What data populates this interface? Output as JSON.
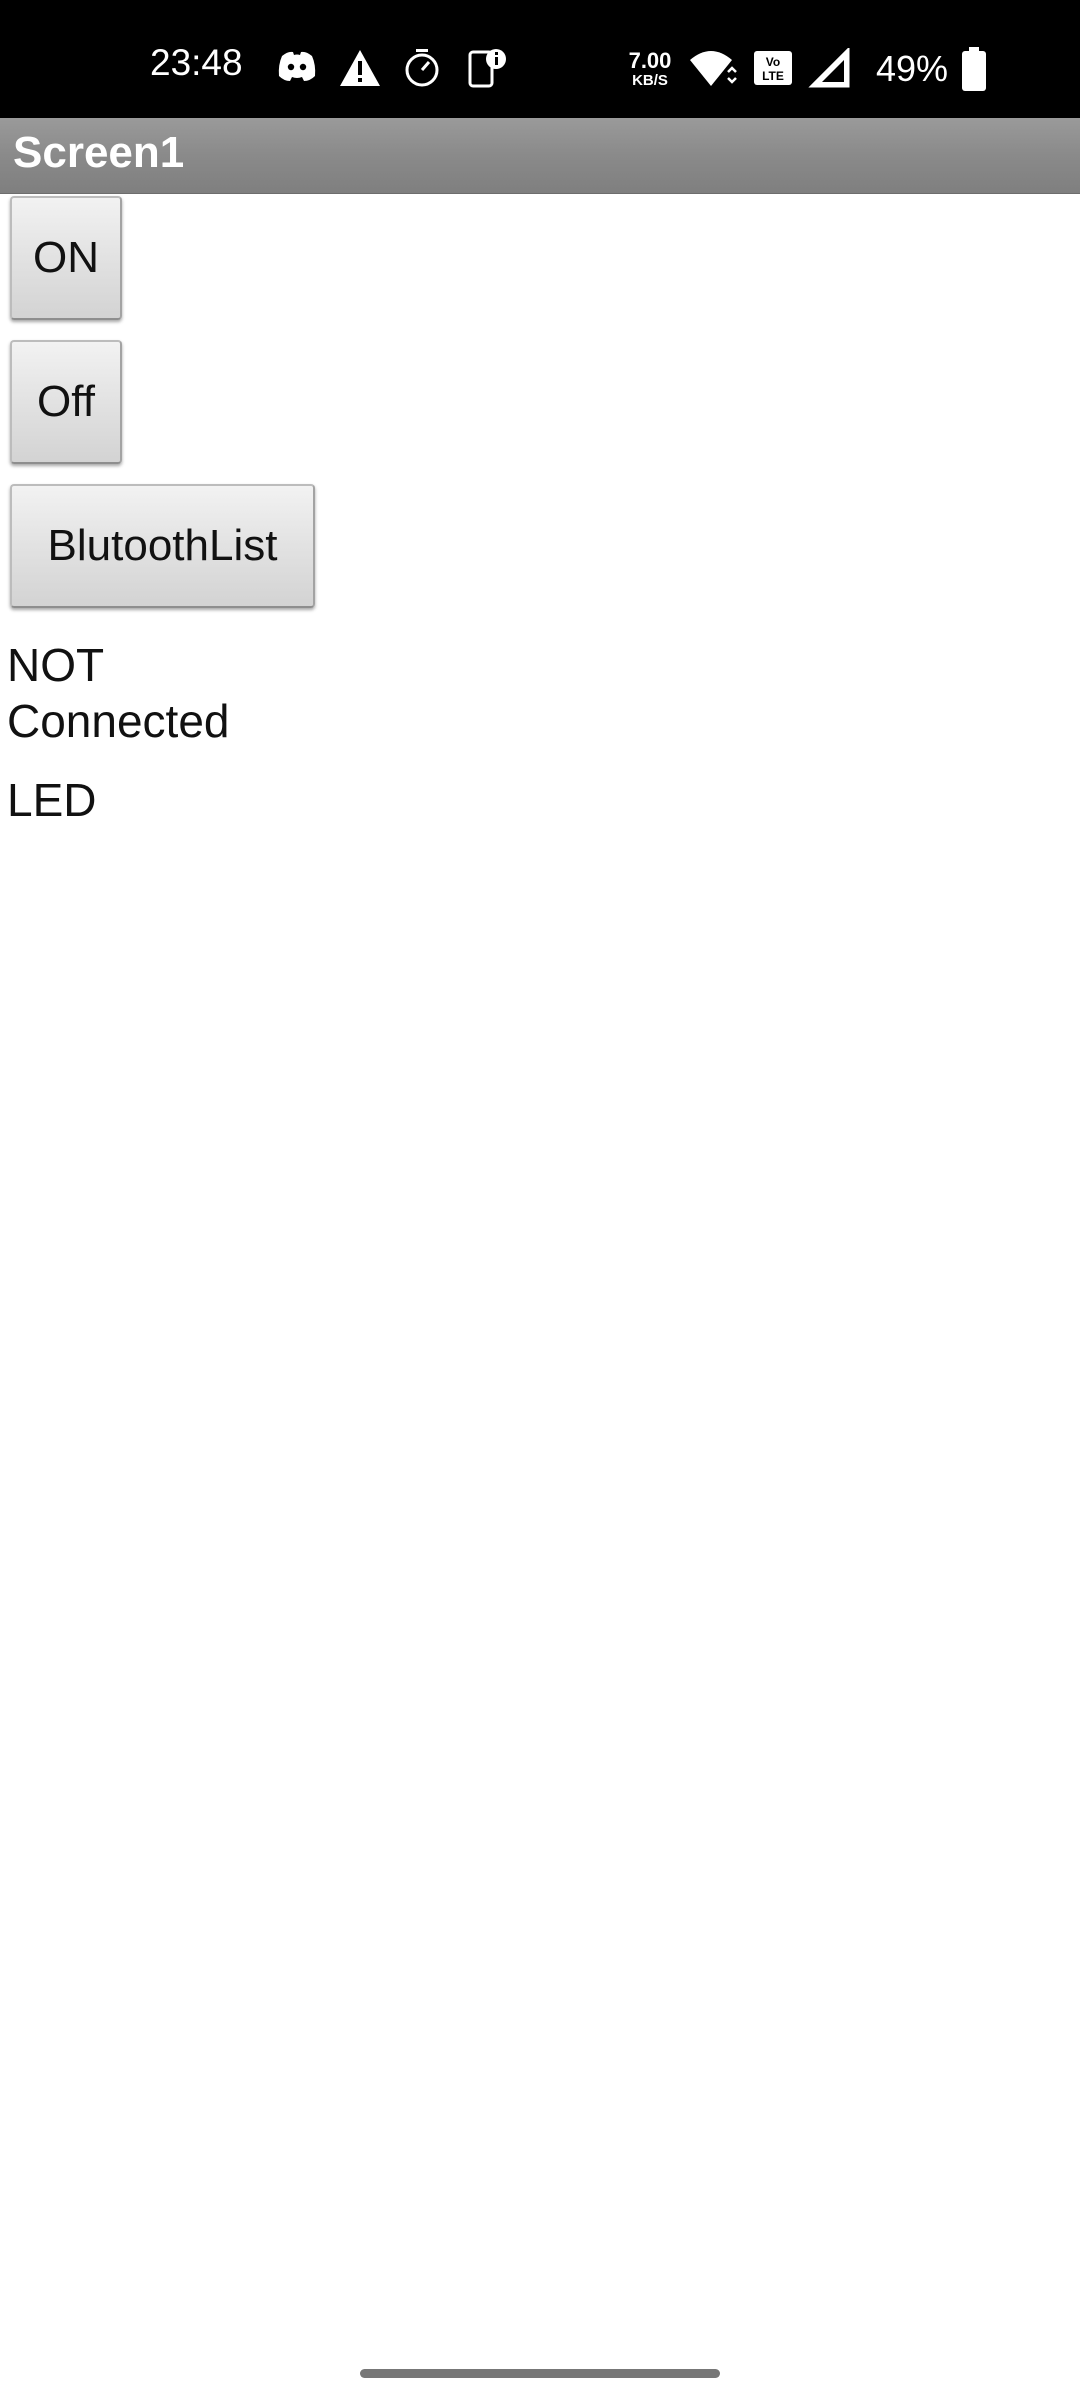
{
  "status_bar": {
    "time": "23:48",
    "net_speed_value": "7.00",
    "net_speed_unit": "KB/S",
    "battery_percent": "49%",
    "icons": [
      "discord-icon",
      "warning-icon",
      "timer-icon",
      "phone-info-icon",
      "wifi-icon",
      "volte-icon",
      "signal-icon",
      "battery-icon"
    ]
  },
  "title_bar": {
    "title": "Screen1",
    "color": "#8c8c8c"
  },
  "buttons": {
    "on_label": "ON",
    "off_label": "Off",
    "bluetooth_label": "BlutoothList"
  },
  "labels": {
    "connection_status": "NOT Connected",
    "led": "LED"
  }
}
